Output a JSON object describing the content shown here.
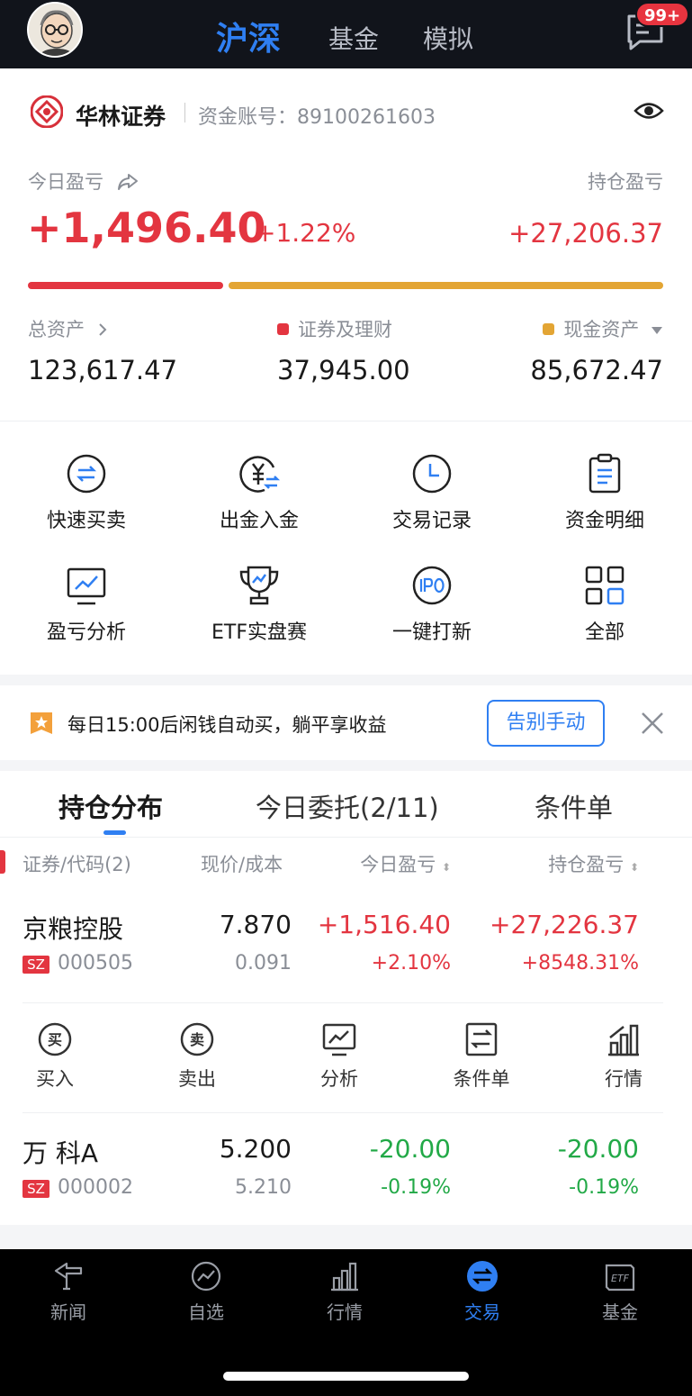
{
  "top": {
    "tabs": [
      "沪深",
      "基金",
      "模拟"
    ],
    "badge": "99+"
  },
  "account": {
    "broker": "华林证券",
    "account_label": "资金账号：",
    "account_no": "89100261603",
    "today_pl_label": "今日盈亏",
    "today_pl": "+1,496.40",
    "today_pl_pct": "+1.22%",
    "hold_pl_label": "持仓盈亏",
    "hold_pl": "+27,206.37",
    "total_assets_label": "总资产",
    "total_assets": "123,617.47",
    "securities_label": "证券及理财",
    "securities": "37,945.00",
    "cash_label": "现金资产",
    "cash": "85,672.47",
    "colors": {
      "red": "#e33540",
      "gold": "#e3a534"
    }
  },
  "grid": [
    {
      "label": "快速买卖",
      "icon": "swap-circle-icon"
    },
    {
      "label": "出金入金",
      "icon": "yuan-transfer-icon"
    },
    {
      "label": "交易记录",
      "icon": "clock-icon"
    },
    {
      "label": "资金明细",
      "icon": "clipboard-icon"
    },
    {
      "label": "盈亏分析",
      "icon": "monitor-chart-icon"
    },
    {
      "label": "ETF实盘赛",
      "icon": "trophy-icon"
    },
    {
      "label": "一键打新",
      "icon": "ipo-icon"
    },
    {
      "label": "全部",
      "icon": "grid-icon"
    }
  ],
  "promo": {
    "text": "每日15:00后闲钱自动买，躺平享收益",
    "button": "告别手动"
  },
  "holdings": {
    "tabs": [
      "持仓分布",
      "今日委托(2/11)",
      "条件单"
    ],
    "headers": [
      "证券/代码(2)",
      "现价/成本",
      "今日盈亏",
      "持仓盈亏"
    ],
    "rows": [
      {
        "name": "京粮控股",
        "market": "SZ",
        "code": "000505",
        "price": "7.870",
        "cost": "0.091",
        "today_pl": "+1,516.40",
        "today_pct": "+2.10%",
        "hold_pl": "+27,226.37",
        "hold_pct": "+8548.31%"
      },
      {
        "name": "万 科A",
        "market": "SZ",
        "code": "000002",
        "price": "5.200",
        "cost": "5.210",
        "today_pl": "-20.00",
        "today_pct": "-0.19%",
        "hold_pl": "-20.00",
        "hold_pct": "-0.19%"
      }
    ],
    "actions": [
      "买入",
      "卖出",
      "分析",
      "条件单",
      "行情"
    ]
  },
  "tabbar": [
    {
      "label": "新闻",
      "icon": "news-icon"
    },
    {
      "label": "自选",
      "icon": "watchlist-icon"
    },
    {
      "label": "行情",
      "icon": "market-icon"
    },
    {
      "label": "交易",
      "icon": "trade-icon",
      "active": true
    },
    {
      "label": "基金",
      "icon": "etf-icon"
    }
  ]
}
